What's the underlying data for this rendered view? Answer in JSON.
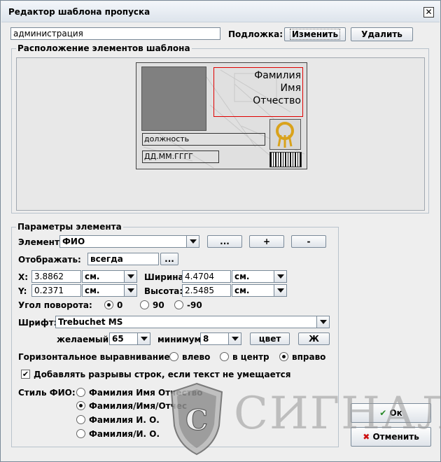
{
  "window": {
    "title": "Редактор шаблона пропуска",
    "close_glyph": "✕"
  },
  "template": {
    "name_value": "администрация",
    "background_label": "Подложка:",
    "change_button": "Изменить",
    "delete_button": "Удалить"
  },
  "layout_group": {
    "title": "Расположение элементов шаблона",
    "card": {
      "surname": "Фамилия",
      "name": "Имя",
      "patronymic": "Отчество",
      "position": "должность",
      "date": "ДД.ММ.ГГГГ"
    }
  },
  "params_group": {
    "title": "Параметры элемента",
    "element_label": "Элемент:",
    "element_value": "ФИО",
    "element_more_button": "...",
    "element_add_button": "+",
    "element_remove_button": "-",
    "display_label": "Отображать:",
    "display_value": "всегда",
    "display_more_button": "...",
    "x_label": "X:",
    "x_value": "3.8862",
    "x_unit": "см.",
    "y_label": "Y:",
    "y_value": "0.2371",
    "y_unit": "см.",
    "width_label": "Ширина:",
    "width_value": "4.4704",
    "width_unit": "см.",
    "height_label": "Высота:",
    "height_value": "2.5485",
    "height_unit": "см.",
    "rotation_label": "Угол поворота:",
    "rotation_options": [
      "0",
      "90",
      "-90"
    ],
    "rotation_selected": "0",
    "font_label": "Шрифт:",
    "font_value": "Trebuchet MS",
    "desired_label": "желаемый:",
    "desired_value": "65",
    "minimum_label": "минимум:",
    "minimum_value": "8",
    "color_button": "цвет",
    "bold_button": "Ж",
    "halign_label": "Горизонтальное выравнивание:",
    "halign_options": [
      "влево",
      "в центр",
      "вправо"
    ],
    "halign_selected": "вправо",
    "wrap_label": "Добавлять разрывы строк, если текст не умещается",
    "wrap_checked": true,
    "fio_style_label": "Стиль ФИО:",
    "fio_style_options": [
      "Фамилия Имя Отчество",
      "Фамилия/Имя/Отчес",
      "Фамилия И. О.",
      "Фамилия/И. О."
    ],
    "fio_style_selected": "Фамилия/Имя/Отчес"
  },
  "footer": {
    "ok_button": "Ок",
    "cancel_button": "Отменить"
  },
  "watermark": {
    "text": "СИГНАЛ"
  }
}
